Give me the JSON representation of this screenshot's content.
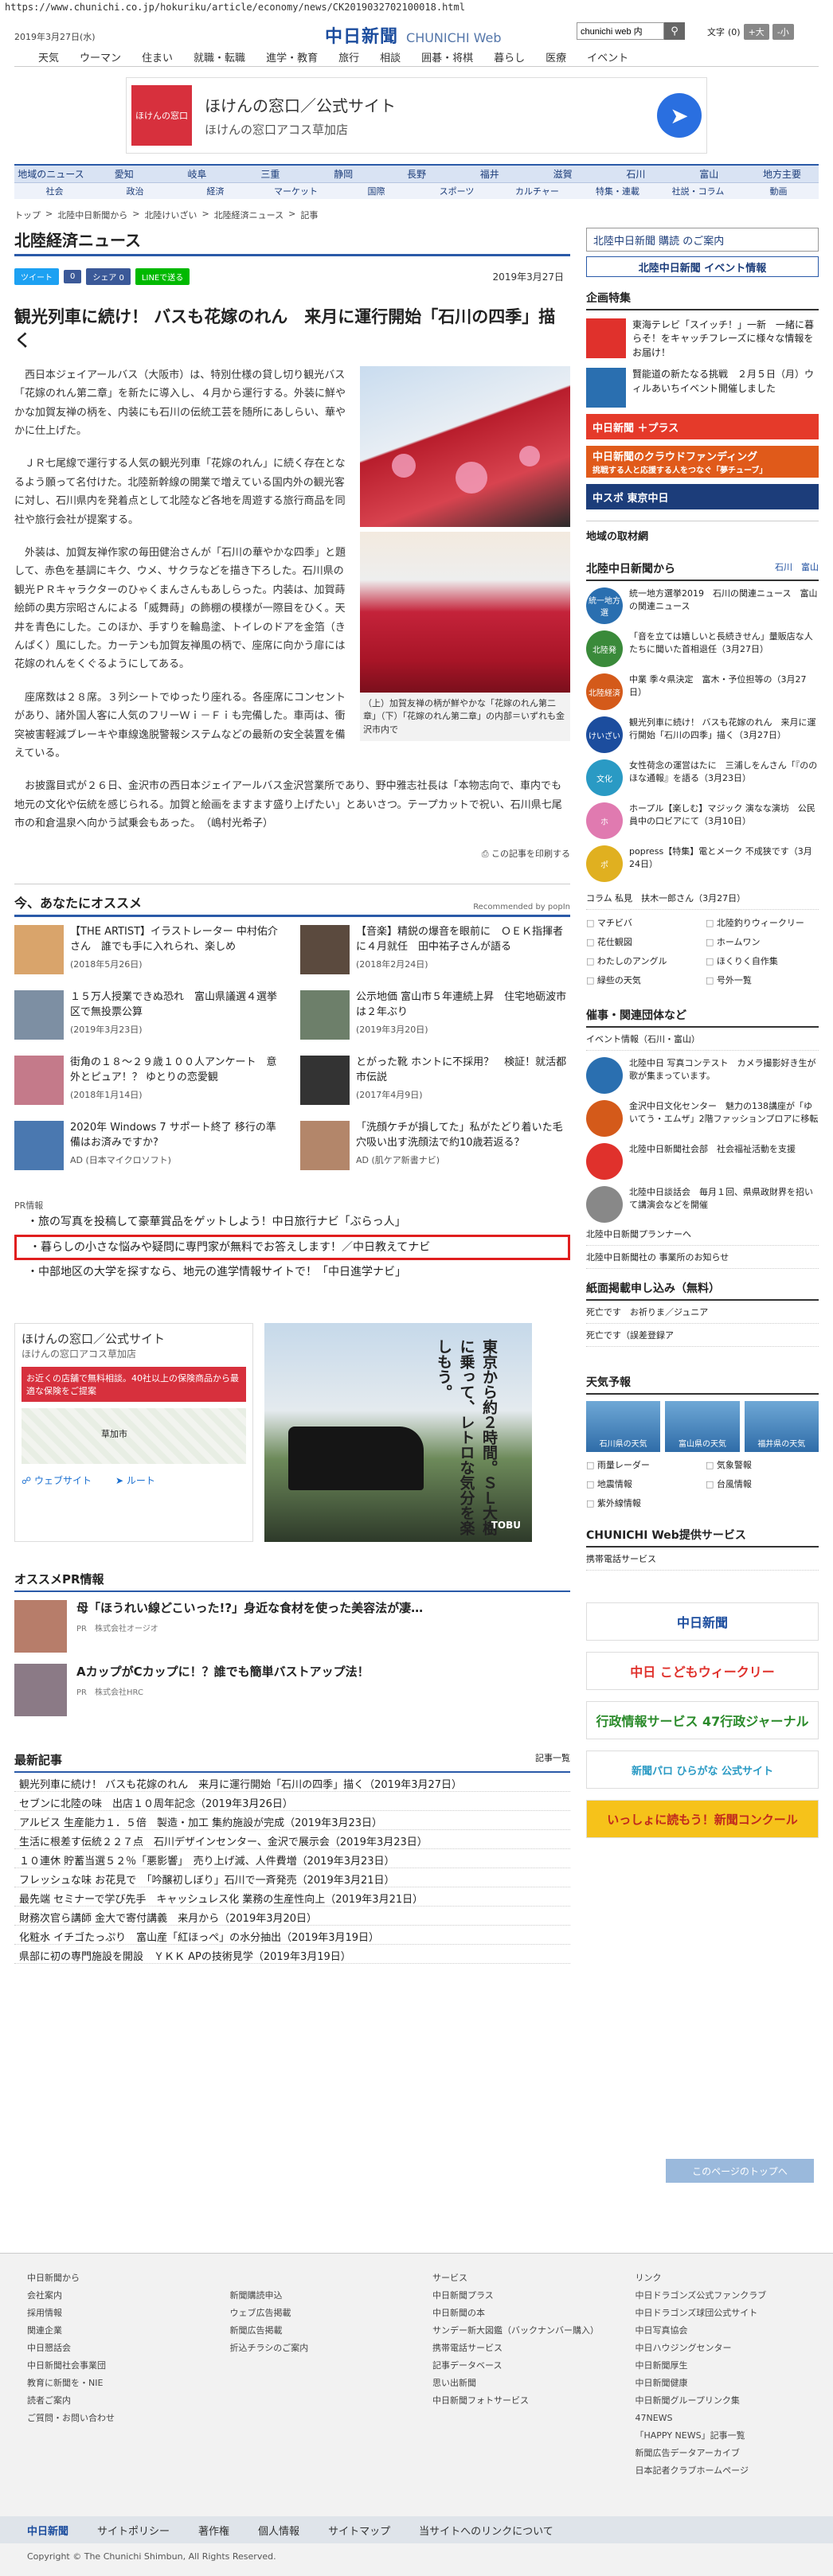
{
  "url": "https://www.chunichi.co.jp/hokuriku/article/economy/news/CK2019032702100018.html",
  "header": {
    "date": "2019年3月27日(水)",
    "logo_ja": "中日新聞",
    "logo_en": "CHUNICHI Web",
    "search_value": "chunichi web 内",
    "font_label": "文字",
    "font_zero": "(0)",
    "font_big": "+大",
    "font_small": "-小",
    "topnav": [
      "天気",
      "ウーマン",
      "住まい",
      "就職・転職",
      "進学・教育",
      "旅行",
      "相談",
      "囲碁・将棋",
      "暮らし",
      "医療",
      "イベント"
    ]
  },
  "ad_top": {
    "logo": "ほけんの窓口",
    "line1": "ほけんの窓口／公式サイト",
    "line2": "ほけんの窓口アコス草加店"
  },
  "nav2": {
    "row1": [
      "地域のニュース",
      "愛知",
      "岐阜",
      "三重",
      "静岡",
      "長野",
      "福井",
      "滋賀",
      "石川",
      "富山",
      "地方主要"
    ],
    "row2": [
      "社会",
      "政治",
      "経済",
      "マーケット",
      "国際",
      "スポーツ",
      "カルチャー",
      "特集・連載",
      "社説・コラム",
      "動画"
    ]
  },
  "breadcrumb": [
    "トップ",
    "北陸中日新聞から",
    "北陸けいざい",
    "北陸経済ニュース",
    "記事"
  ],
  "section_title": "北陸経済ニュース",
  "share": {
    "tweet": "ツイート",
    "like": "0",
    "fb": "シェア 0",
    "line": "LINEで送る",
    "date": "2019年3月27日"
  },
  "article": {
    "title": "観光列車に続け！ バスも花嫁のれん　来月に運行開始「石川の四季」描く",
    "paragraphs": [
      "西日本ジェイアールバス（大阪市）は、特別仕様の貸し切り観光バス「花嫁のれん第二章」を新たに導入し、４月から運行する。外装に鮮やかな加賀友禅の柄を、内装にも石川の伝統工芸を随所にあしらい、華やかに仕上げた。",
      "ＪＲ七尾線で運行する人気の観光列車「花嫁のれん」に続く存在となるよう願って名付けた。北陸新幹線の開業で増えている国内外の観光客に対し、石川県内を発着点として北陸など各地を周遊する旅行商品を同社や旅行会社が提案する。",
      "外装は、加賀友禅作家の毎田健治さんが「石川の華やかな四季」と題して、赤色を基調にキク、ウメ、サクラなどを描き下ろした。石川県の観光ＰＲキャラクターのひゃくまんさんもあしらった。内装は、加賀蒔絵師の奥方宗昭さんによる「威舞蒔」の飾棚の模様が一際目をひく。天井を青色にした。このほか、手すりを輪島塗、トイレのドアを金箔（きんぱく）風にした。カーテンも加賀友禅風の柄で、座席に向かう扉には花嫁のれんをくぐるようにしてある。",
      "座席数は２８席。３列シートでゆったり座れる。各座席にコンセントがあり、諸外国人客に人気のフリーＷｉ－Ｆｉも完備した。車両は、衝突被害軽減ブレーキや車線逸脱警報システムなどの最新の安全装置を備えている。",
      "お披露目式が２６日、金沢市の西日本ジェイアールバス金沢営業所であり、野中雅志社長は「本物志向で、車内でも地元の文化や伝統を感じられる。加賀と絵画をますます盛り上げたい」とあいさつ。テープカットで祝い、石川県七尾市の和倉温泉へ向かう試乗会もあった。　（嶋村光希子）"
    ],
    "caption": "（上）加賀友禅の柄が鮮やかな「花嫁のれん第二章」（下）「花嫁のれん第二章」の内部＝いずれも金沢市内で",
    "print": "この記事を印刷する"
  },
  "recommend": {
    "title": "今、あなたにオススメ",
    "by": "Recommended by popIn",
    "items": [
      {
        "t": "【THE ARTIST】イラストレーター 中村佑介さん　誰でも手に入れられ、楽しめ",
        "s": "(2018年5月26日)",
        "c": "#d9a46b"
      },
      {
        "t": "【音楽】精鋭の爆音を眼前に　ＯＥＫ指揮者に４月就任　田中祐子さんが語る",
        "s": "(2018年2月24日)",
        "c": "#5b4a3e"
      },
      {
        "t": "１５万人授業できぬ恐れ　富山県議選４選挙区で無投票公算",
        "s": "(2019年3月23日)",
        "c": "#7d8fa3"
      },
      {
        "t": "公示地価 富山市５年連続上昇　住宅地砺波市は２年ぶり",
        "s": "(2019年3月20日)",
        "c": "#6d7f6a"
      },
      {
        "t": "街角の１８～２９歳１００人アンケート　意外とピュア！？ ゆとりの恋愛観",
        "s": "(2018年1月14日)",
        "c": "#c47a8a"
      },
      {
        "t": "とがった靴 ホントに不採用？　検証！就活都市伝説",
        "s": "(2017年4月9日)",
        "c": "#333"
      },
      {
        "t": "2020年 Windows 7 サポート終了 移行の準備はお済みですか?",
        "s": "AD (日本マイクロソフト)",
        "c": "#4a78b0"
      },
      {
        "t": "「洗顔ケチが損してた」私がたどり着いた毛穴吸い出す洗顔法で約10歳若返る？",
        "s": "AD (肌ケア新書ナビ)",
        "c": "#b3866a"
      }
    ]
  },
  "pr": {
    "label": "PR情報",
    "items": [
      "旅の写真を投稿して豪華賞品をゲットしよう！中日旅行ナビ「ぶらっ人」",
      "暮らしの小さな悩みや疑問に専門家が無料でお答えします！／中日教えてナビ",
      "中部地区の大学を探すなら、地元の進学情報サイトで！「中日進学ナビ」"
    ]
  },
  "ad_map": {
    "h": "ほけんの窓口／公式サイト",
    "s": "ほけんの窓口アコス草加店",
    "red": "お近くの店舗で無料相談。40社以上の保険商品から最適な保険をご提案",
    "place": "草加市",
    "web": "ウェブサイト",
    "route": "ルート"
  },
  "ad_train": {
    "copy": "東京から約２時間。ＳＬ大樹に乗って、レトロな気分を楽しもう。",
    "brand": "TOBU"
  },
  "ospr": {
    "title": "オススメPR情報",
    "items": [
      {
        "t": "母「ほうれい線どこいった!?」身近な食材を使った美容法が凄…",
        "s": "PR　株式会社オージオ"
      },
      {
        "t": "AカップがCカップに！？誰でも簡単バストアップ法！",
        "s": "PR　株式会社HRC"
      }
    ]
  },
  "latest": {
    "title": "最新記事",
    "link": "記事一覧",
    "items": [
      "観光列車に続け！ バスも花嫁のれん　来月に運行開始「石川の四季」描く（2019年3月27日）",
      "セブンに北陸の味　出店１０周年記念（2019年3月26日）",
      "アルビス 生産能力１．５倍　製造・加工 集約施設が完成（2019年3月23日）",
      "生活に根差す伝統２２７点　石川デザインセンター、金沢で展示会（2019年3月23日）",
      "１０連休 貯蓄当選５２％「悪影響」　売り上げ減、人件費増（2019年3月23日）",
      "フレッシュな味 お花見で　「吟醸初しぼり」石川で一斉発売（2019年3月21日）",
      "最先端 セミナーで学び先手　キャッシュレス化 業務の生産性向上（2019年3月21日）",
      "財務次官ら講師 金大で寄付講義　来月から（2019年3月20日）",
      "化粧水 イチゴたっぷり　富山産「紅ほっぺ」の水分抽出（2019年3月19日）",
      "県部に初の専門施設を開設　ＹＫＫ APの技術見学（2019年3月19日）"
    ]
  },
  "side": {
    "btn1": "北陸中日新聞 購読 のご案内",
    "btn2": "北陸中日新聞 イベント情報",
    "kikaku": "企画特集",
    "kikaku_items": [
      "東海テレビ「スイッチ！」一新　一緒に暮らそ！をキャッチフレーズに様々な情報をお届け！",
      "賢能道の新たなる挑戦　２月５日（月）ウィルあいちイベント開催しました"
    ],
    "plus": "中日新聞 ＋プラス",
    "cf": "中日新聞のクラウドファンディング",
    "cf_sub": "挑戦する人と応援する人をつなぐ「夢チューブ」",
    "chuspo": "中スポ 東京中日",
    "chiiki": "地域の取材網",
    "hokuriku": "北陸中日新聞から",
    "hk_tabs": [
      "石川",
      "富山"
    ],
    "hk_items": [
      {
        "ic": "統一地方選",
        "c": "#2a6fb0",
        "t": "統一地方選挙2019　石川の関連ニュース　富山の関連ニュース"
      },
      {
        "ic": "北陸発",
        "c": "#3a8a3a",
        "t": "「音を立ては嬉しいと長続きせん」量販店な人たちに聞いた首相退任（3月27日）"
      },
      {
        "ic": "北陸経済",
        "c": "#d45a1a",
        "t": "中業 季々県決定　富木・予位担等の（3月27日）"
      },
      {
        "ic": "けいざい",
        "c": "#1c4d9e",
        "t": "観光列車に続け！ バスも花嫁のれん　来月に運行開始「石川の四季」描く（3月27日）"
      },
      {
        "ic": "文化",
        "c": "#2a9ac4",
        "t": "女性荷念の運営はたに　三浦しをんさん「『ののほな通報』を語る（3月23日）"
      },
      {
        "ic": "ホ",
        "c": "#e07ab0",
        "t": "ホープル【楽しむ】マジック 演なな演坊　公民員中の口ビアにて（3月10日）"
      },
      {
        "ic": "ポ",
        "c": "#e0b020",
        "t": "popress【特集】電とメーク 不成狭です（3月24日）"
      }
    ],
    "column": "コラム 私見　扶木一郎さん（3月27日）",
    "tags": [
      "マチビバ",
      "北陸釣りウィークリー",
      "花仕観図",
      "ホームワン",
      "わたしのアングル",
      "ほくりく自作集",
      "緑些の天気",
      "号外一覧"
    ],
    "jiken": "催事・関連団体など",
    "jiken_sub": "イベント情報（石川・富山）",
    "jiken_items": [
      "北陸中日 写真コンテスト　カメラ撮影好き生が歌が集まっています。",
      "金沢中日文化センター　魅力の138講座が「ゆいてう・エムザ」2階ファッションプロアに移転",
      "北陸中日新聞社会部　社会福祉活動を支援",
      "北陸中日談話会　毎月１回、県県政財界を招いて講演会などを開催"
    ],
    "links": [
      "北陸中日新聞プランナーへ",
      "北陸中日新聞社の 事業所のお知らせ"
    ],
    "shimen": "紙面掲載申し込み（無料）",
    "shimen_items": [
      "死亡です　お祈りま／ジュニア",
      "死亡です（誤差登録ア"
    ],
    "tenki": "天気予報",
    "tenki_items": [
      "石川県の天気",
      "富山県の天気",
      "福井県の天気"
    ],
    "tenki_links": [
      "雨量レーダー",
      "気象警報",
      "地震情報",
      "台風情報",
      "紫外線情報"
    ],
    "svc": "CHUNICHI Web提供サービス",
    "svc_item": "携帯電話サービス",
    "banners": [
      "中日新聞",
      "中日 こどもウィークリー",
      "行政情報サービス 47行政ジャーナル",
      "新聞パロ ひらがな 公式サイト",
      "いっしょに読もう！新聞コンクール"
    ]
  },
  "toplink": "このページのトップへ",
  "footer": {
    "c1": [
      "中日新聞から",
      "会社案内",
      "採用情報",
      "関連企業",
      "中日懇話会",
      "中日新聞社会事業団",
      "教育に新聞を・NIE",
      "読者ご案内",
      "ご質問・お問い合わせ"
    ],
    "c2": [
      "新聞購読申込",
      "ウェブ広告掲載",
      "新聞広告掲載",
      "折込チラシのご案内"
    ],
    "c3": [
      "サービス",
      "中日新聞プラス",
      "中日新聞の本",
      "サンデー新大図鑑（バックナンバー購入）",
      "携帯電話サービス",
      "記事データベース",
      "思い出新聞",
      "中日新聞フォトサービス"
    ],
    "c4": [
      "リンク",
      "中日ドラゴンズ公式ファンクラブ",
      "中日ドラゴンズ球団公式サイト",
      "中日写真協会",
      "中日ハウジングセンター",
      "中日新聞厚生",
      "中日新聞健康",
      "中日新聞グループリンク集",
      "47NEWS",
      "「HAPPY NEWS」記事一覧",
      "新聞広告データアーカイブ",
      "日本記者クラブホームページ"
    ],
    "bar": [
      "中日新聞",
      "サイトポリシー",
      "著作権",
      "個人情報",
      "サイトマップ",
      "当サイトへのリンクについて"
    ],
    "copy": "Copyright © The Chunichi Shimbun, All Rights Reserved."
  }
}
